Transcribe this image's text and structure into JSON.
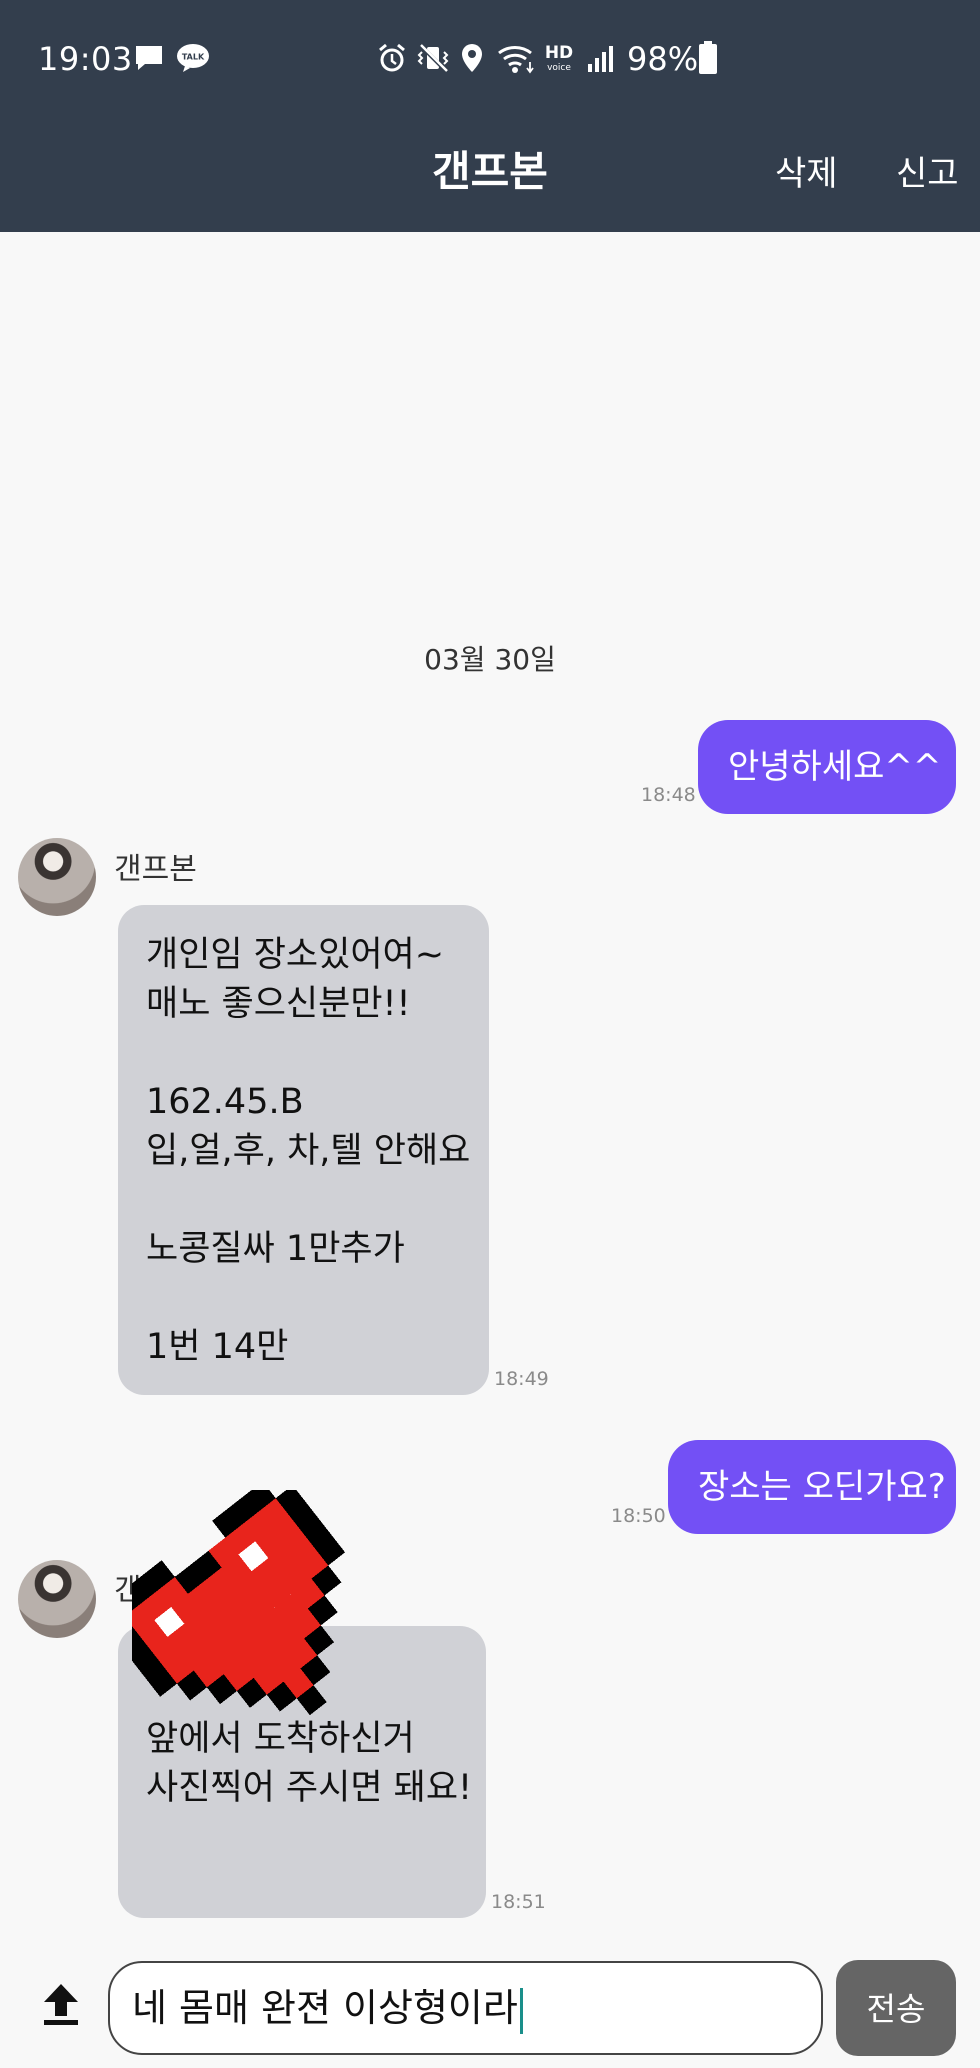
{
  "status_bar": {
    "time": "19:03",
    "hd_label": "HD",
    "voice_label": "voice",
    "battery": "98%",
    "icons": [
      "message-icon",
      "kakaotalk-icon",
      "alarm-icon",
      "vibrate-icon",
      "location-icon",
      "wifi-icon",
      "hd-voice-icon",
      "signal-icon",
      "battery-icon"
    ],
    "talk_badge": "TALK"
  },
  "header": {
    "title": "갠프본",
    "delete_label": "삭제",
    "report_label": "신고",
    "background": "#333e4d"
  },
  "chat": {
    "date": "03월 30일",
    "messages": [
      {
        "direction": "out",
        "text": "안녕하세요^^",
        "time": "18:48"
      },
      {
        "direction": "in",
        "sender": "갠프본",
        "lines": [
          "개인임 장소있어여~",
          "매노 좋으신분만!!",
          "",
          "162.45.B",
          "입,얼,후, 차,텔 안해요",
          "",
          "노콩질싸 1만추가",
          "",
          "1번 14만"
        ],
        "time": "18:49"
      },
      {
        "direction": "out",
        "text": "장소는 오딘가요?",
        "time": "18:50"
      },
      {
        "direction": "in",
        "sender": "갠프본",
        "lines": [
          "",
          "앞에서 도착하신거",
          "사진찍어 주시면 돼요!"
        ],
        "time": "18:51"
      }
    ],
    "outgoing_color": "#7350f5",
    "incoming_color": "#d0d1d6"
  },
  "input": {
    "value": "네 몸매 완젼 이상형이라",
    "send_label": "전송"
  }
}
